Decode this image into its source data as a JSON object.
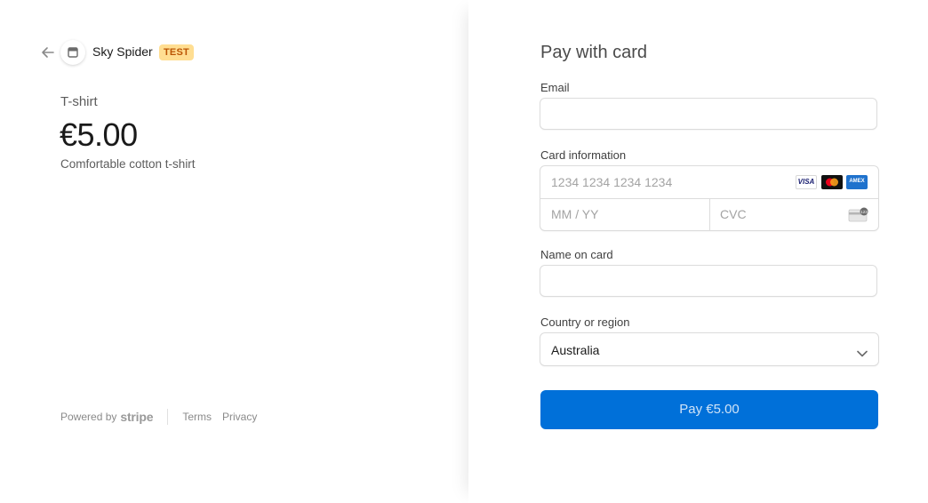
{
  "merchant": {
    "name": "Sky Spider",
    "badge": "TEST"
  },
  "product": {
    "name": "T-shirt",
    "price": "€5.00",
    "description": "Comfortable cotton t-shirt"
  },
  "footer": {
    "powered_by": "Powered by",
    "stripe": "stripe",
    "terms": "Terms",
    "privacy": "Privacy"
  },
  "form": {
    "title": "Pay with card",
    "email_label": "Email",
    "email_value": "",
    "card_label": "Card information",
    "card_number_placeholder": "1234 1234 1234 1234",
    "expiry_placeholder": "MM / YY",
    "cvc_placeholder": "CVC",
    "card_brands": [
      "visa-icon",
      "mastercard-icon",
      "amex-icon"
    ],
    "name_label": "Name on card",
    "name_value": "",
    "country_label": "Country or region",
    "country_value": "Australia",
    "pay_button": "Pay €5.00"
  },
  "colors": {
    "accent": "#0070d9",
    "test_badge_bg": "#ffde92",
    "test_badge_text": "#bb5504"
  }
}
